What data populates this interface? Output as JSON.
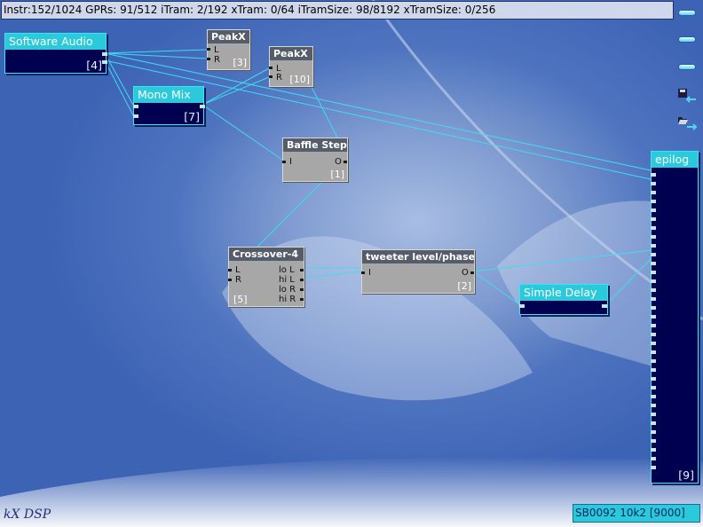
{
  "status_bar": {
    "text": "Instr:152/1024 GPRs: 91/512 iTram: 2/192 xTram: 0/64 iTramSize: 98/8192 xTramSize: 0/256"
  },
  "sidebar": {
    "buttons": [
      {
        "name": "menu-button-1",
        "icon": "menu-bar-icon"
      },
      {
        "name": "menu-button-2",
        "icon": "menu-bar-icon"
      },
      {
        "name": "menu-button-3",
        "icon": "menu-bar-icon"
      },
      {
        "name": "save-button",
        "icon": "floppy-disk-icon"
      },
      {
        "name": "open-button",
        "icon": "folder-open-icon"
      }
    ]
  },
  "plugins": {
    "software_audio": {
      "title": "Software Audio",
      "id": "[4]"
    },
    "mono_mix": {
      "title": "Mono Mix",
      "id": "[7]"
    },
    "peakx_1": {
      "title": "PeakX",
      "id": "[3]",
      "in_l": "L",
      "in_r": "R"
    },
    "peakx_2": {
      "title": "PeakX",
      "id": "[10]",
      "in_l": "L",
      "in_r": "R"
    },
    "baffle_step": {
      "title": "Baffle Step",
      "id": "[1]",
      "in": "I",
      "out": "O"
    },
    "crossover": {
      "title": "Crossover-4",
      "id": "[5]",
      "in_l": "L",
      "in_r": "R",
      "out_lo_l": "lo L",
      "out_hi_l": "hi L",
      "out_lo_r": "lo R",
      "out_hi_r": "hi R"
    },
    "tweeter": {
      "title": "tweeter level/phase",
      "id": "[2]",
      "in": "I",
      "out": "O"
    },
    "simple_delay": {
      "title": "Simple Delay"
    },
    "epilog": {
      "title": "epilog",
      "id": "[9]"
    }
  },
  "footer": {
    "logo": "kX DSP",
    "device": "SB0092 10k2 [9000]"
  },
  "colors": {
    "wire": "#3fdcf0",
    "cyan_title": "#2bc9dc",
    "box_dark": "#000050",
    "gray_box": "#a7a7a7"
  }
}
